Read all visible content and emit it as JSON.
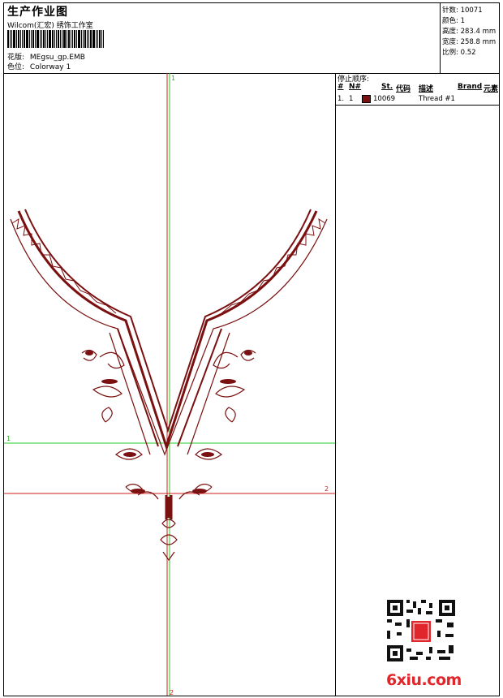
{
  "header": {
    "title": "生产作业图",
    "subtitle": "Wilcom(汇宏) 绣饰工作室",
    "design_label": "花版:",
    "design_value": "MEgsu_gp.EMB",
    "colorway_label": "色位:",
    "colorway_value": "Colorway 1"
  },
  "stats": [
    {
      "label": "针数:",
      "value": "10071"
    },
    {
      "label": "颜色:",
      "value": "1"
    },
    {
      "label": "高度:",
      "value": "283.4 mm"
    },
    {
      "label": "宽度:",
      "value": "258.8 mm"
    },
    {
      "label": "比例:",
      "value": "0.52"
    }
  ],
  "stop_sequence": {
    "title": "停止顺序:",
    "columns": [
      "#",
      "N#",
      "St.",
      "代码",
      "描述",
      "Brand",
      "元素"
    ],
    "rows": [
      {
        "index": "1.",
        "needle": "1",
        "code": "10069",
        "description": "Thread #1",
        "color": "#7a1010"
      }
    ]
  },
  "guides": {
    "vertical_top": "1",
    "vertical_bottom": "2",
    "horizontal_green": "1",
    "horizontal_red": "2"
  },
  "watermark": "6xiu.com",
  "colors": {
    "thread": "#7a1010",
    "guide_green": "#22cc22",
    "guide_red": "#cc2222"
  }
}
